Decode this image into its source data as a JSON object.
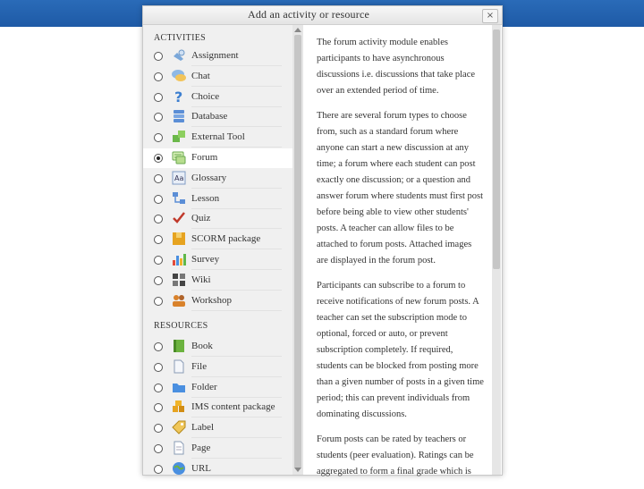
{
  "dialog": {
    "title": "Add an activity or resource",
    "close_label": "×"
  },
  "activities": {
    "heading": "ACTIVITIES",
    "items": [
      {
        "label": "Assignment",
        "icon": "assignment-icon"
      },
      {
        "label": "Chat",
        "icon": "chat-icon"
      },
      {
        "label": "Choice",
        "icon": "choice-icon"
      },
      {
        "label": "Database",
        "icon": "database-icon"
      },
      {
        "label": "External Tool",
        "icon": "external-tool-icon"
      },
      {
        "label": "Forum",
        "icon": "forum-icon",
        "selected": true
      },
      {
        "label": "Glossary",
        "icon": "glossary-icon"
      },
      {
        "label": "Lesson",
        "icon": "lesson-icon"
      },
      {
        "label": "Quiz",
        "icon": "quiz-icon"
      },
      {
        "label": "SCORM package",
        "icon": "scorm-icon"
      },
      {
        "label": "Survey",
        "icon": "survey-icon"
      },
      {
        "label": "Wiki",
        "icon": "wiki-icon"
      },
      {
        "label": "Workshop",
        "icon": "workshop-icon"
      }
    ]
  },
  "resources": {
    "heading": "RESOURCES",
    "items": [
      {
        "label": "Book",
        "icon": "book-icon"
      },
      {
        "label": "File",
        "icon": "file-icon"
      },
      {
        "label": "Folder",
        "icon": "folder-icon"
      },
      {
        "label": "IMS content package",
        "icon": "ims-package-icon"
      },
      {
        "label": "Label",
        "icon": "label-icon"
      },
      {
        "label": "Page",
        "icon": "page-icon"
      },
      {
        "label": "URL",
        "icon": "url-icon"
      }
    ]
  },
  "description": {
    "paragraphs": [
      "The forum activity module enables participants to have asynchronous discussions i.e. discussions that take place over an extended period of time.",
      "There are several forum types to choose from, such as a standard forum where anyone can start a new discussion at any time; a forum where each student can post exactly one discussion; or a question and answer forum where students must first post before being able to view other students' posts. A teacher can allow files to be attached to forum posts. Attached images are displayed in the forum post.",
      "Participants can subscribe to a forum to receive notifications of new forum posts. A teacher can set the subscription mode to optional, forced or auto, or prevent subscription completely. If required, students can be blocked from posting more than a given number of posts in a given time period; this can prevent individuals from dominating discussions.",
      "Forum posts can be rated by teachers or students (peer evaluation). Ratings can be aggregated to form a final grade which is"
    ]
  },
  "colors": {
    "topbar": "#1e5aa6",
    "panel_bg": "#f0f0f0",
    "selected_bg": "#ffffff"
  }
}
